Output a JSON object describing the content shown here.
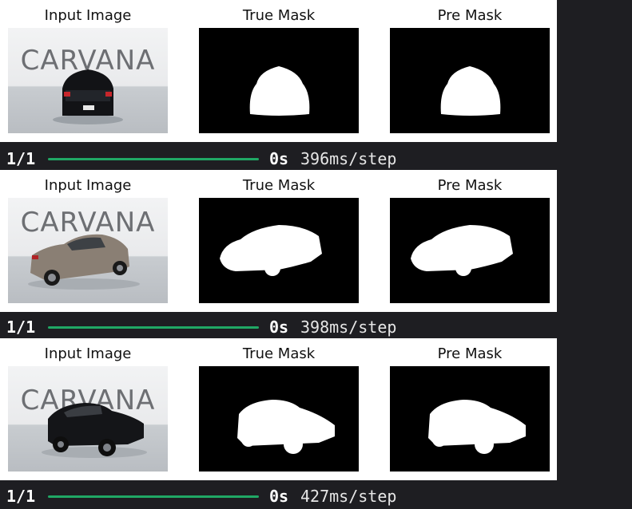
{
  "columns": [
    "Input Image",
    "True Mask",
    "Pre Mask"
  ],
  "watermark": "CARVANA",
  "rows": [
    {
      "car": "sedan-rear",
      "progress": {
        "step": "1/1",
        "fraction": 1.0,
        "eta": "0s",
        "speed": "396ms/step"
      }
    },
    {
      "car": "sedan-side",
      "progress": {
        "step": "1/1",
        "fraction": 1.0,
        "eta": "0s",
        "speed": "398ms/step"
      }
    },
    {
      "car": "suv-side",
      "progress": {
        "step": "1/1",
        "fraction": 1.0,
        "eta": "0s",
        "speed": "427ms/step"
      }
    }
  ],
  "colors": {
    "progress": "#20a865",
    "background": "#1e1e22",
    "mask_fg": "#ffffff",
    "mask_bg": "#000000"
  }
}
